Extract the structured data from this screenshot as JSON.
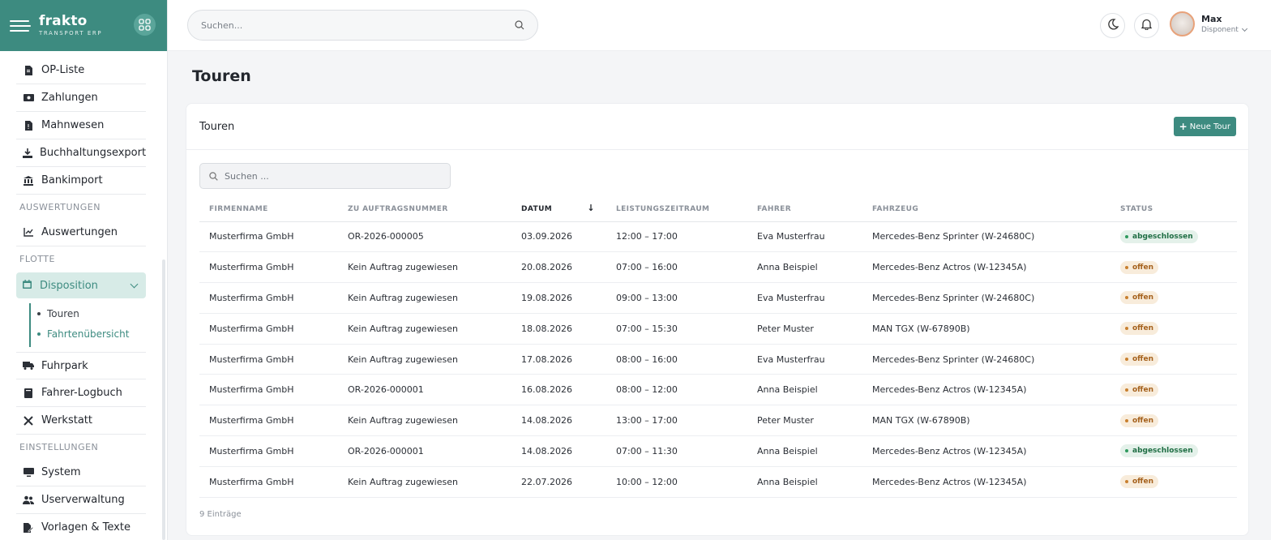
{
  "brand": {
    "name": "frakto",
    "subtitle": "TRANSPORT ERP"
  },
  "header": {
    "search_placeholder": "Suchen...",
    "user": {
      "name": "Max",
      "role": "Disponent"
    }
  },
  "sidebar": {
    "items_top": [
      {
        "label": "OP-Liste",
        "icon": "document-icon"
      },
      {
        "label": "Zahlungen",
        "icon": "money-icon"
      },
      {
        "label": "Mahnwesen",
        "icon": "file-warning-icon"
      },
      {
        "label": "Buchhaltungsexport",
        "icon": "download-icon"
      },
      {
        "label": "Bankimport",
        "icon": "bank-icon"
      }
    ],
    "section_auswertungen": "AUSWERTUNGEN",
    "item_auswertungen": "Auswertungen",
    "section_flotte": "FLOTTE",
    "active_item": "Disposition",
    "submenu": [
      "Touren",
      "Fahrtenübersicht"
    ],
    "items_flotte": [
      {
        "label": "Fuhrpark",
        "icon": "truck-icon"
      },
      {
        "label": "Fahrer-Logbuch",
        "icon": "book-icon"
      },
      {
        "label": "Werkstatt",
        "icon": "tools-icon"
      }
    ],
    "section_einstellungen": "EINSTELLUNGEN",
    "items_einstellungen": [
      {
        "label": "System",
        "icon": "monitor-icon"
      },
      {
        "label": "Userverwaltung",
        "icon": "users-icon"
      },
      {
        "label": "Vorlagen & Texte",
        "icon": "file-edit-icon"
      }
    ]
  },
  "page": {
    "title": "Touren"
  },
  "card": {
    "title": "Touren",
    "new_button": "Neue Tour",
    "search_placeholder": "Suchen ...",
    "footer": "9 Einträge"
  },
  "table": {
    "columns": [
      "FIRMENNAME",
      "ZU AUFTRAGSNUMMER",
      "DATUM",
      "LEISTUNGSZEITRAUM",
      "FAHRER",
      "FAHRZEUG",
      "STATUS"
    ],
    "rows": [
      [
        "Musterfirma GmbH",
        "OR-2026-000005",
        "03.09.2026",
        "12:00 – 17:00",
        "Eva Musterfrau",
        "Mercedes-Benz Sprinter (W-24680C)",
        "abgeschlossen"
      ],
      [
        "Musterfirma GmbH",
        "Kein Auftrag zugewiesen",
        "20.08.2026",
        "07:00 – 16:00",
        "Anna Beispiel",
        "Mercedes-Benz Actros (W-12345A)",
        "offen"
      ],
      [
        "Musterfirma GmbH",
        "Kein Auftrag zugewiesen",
        "19.08.2026",
        "09:00 – 13:00",
        "Eva Musterfrau",
        "Mercedes-Benz Sprinter (W-24680C)",
        "offen"
      ],
      [
        "Musterfirma GmbH",
        "Kein Auftrag zugewiesen",
        "18.08.2026",
        "07:00 – 15:30",
        "Peter Muster",
        "MAN TGX (W-67890B)",
        "offen"
      ],
      [
        "Musterfirma GmbH",
        "Kein Auftrag zugewiesen",
        "17.08.2026",
        "08:00 – 16:00",
        "Eva Musterfrau",
        "Mercedes-Benz Sprinter (W-24680C)",
        "offen"
      ],
      [
        "Musterfirma GmbH",
        "OR-2026-000001",
        "16.08.2026",
        "08:00 – 12:00",
        "Anna Beispiel",
        "Mercedes-Benz Actros (W-12345A)",
        "offen"
      ],
      [
        "Musterfirma GmbH",
        "Kein Auftrag zugewiesen",
        "14.08.2026",
        "13:00 – 17:00",
        "Peter Muster",
        "MAN TGX (W-67890B)",
        "offen"
      ],
      [
        "Musterfirma GmbH",
        "OR-2026-000001",
        "14.08.2026",
        "07:00 – 11:30",
        "Anna Beispiel",
        "Mercedes-Benz Actros (W-12345A)",
        "abgeschlossen"
      ],
      [
        "Musterfirma GmbH",
        "Kein Auftrag zugewiesen",
        "22.07.2026",
        "10:00 – 12:00",
        "Anna Beispiel",
        "Mercedes-Benz Actros (W-12345A)",
        "offen"
      ]
    ]
  },
  "colors": {
    "brand": "#3d8b80",
    "status_done": "#2f9a5e",
    "status_open": "#c9802f"
  }
}
